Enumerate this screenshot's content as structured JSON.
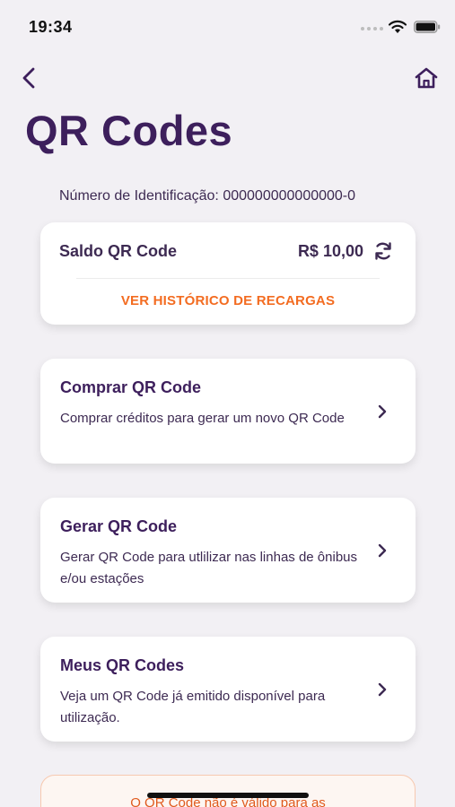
{
  "status_bar": {
    "time": "19:34"
  },
  "nav": {
    "back_icon": "chevron-left-icon",
    "home_icon": "home-icon"
  },
  "page": {
    "title": "QR Codes"
  },
  "identification": {
    "label": "Número de Identificação:",
    "value": "000000000000000-0"
  },
  "balance": {
    "label": "Saldo QR Code",
    "value": "R$ 10,00",
    "refresh_icon": "refresh-icon",
    "history_link": "VER HISTÓRICO DE RECARGAS"
  },
  "menu": [
    {
      "title": "Comprar QR Code",
      "description": "Comprar créditos para gerar um novo QR Code"
    },
    {
      "title": "Gerar QR Code",
      "description": "Gerar QR Code para utlilizar nas linhas de ônibus e/ou estações"
    },
    {
      "title": "Meus QR Codes",
      "description": "Veja um QR Code já emitido disponível para utilização."
    }
  ],
  "notice": {
    "text": "O QR Code não é válido para as"
  },
  "colors": {
    "primary": "#3d1f5c",
    "accent": "#f36c21",
    "background": "#f2f0f4",
    "card": "#ffffff"
  }
}
